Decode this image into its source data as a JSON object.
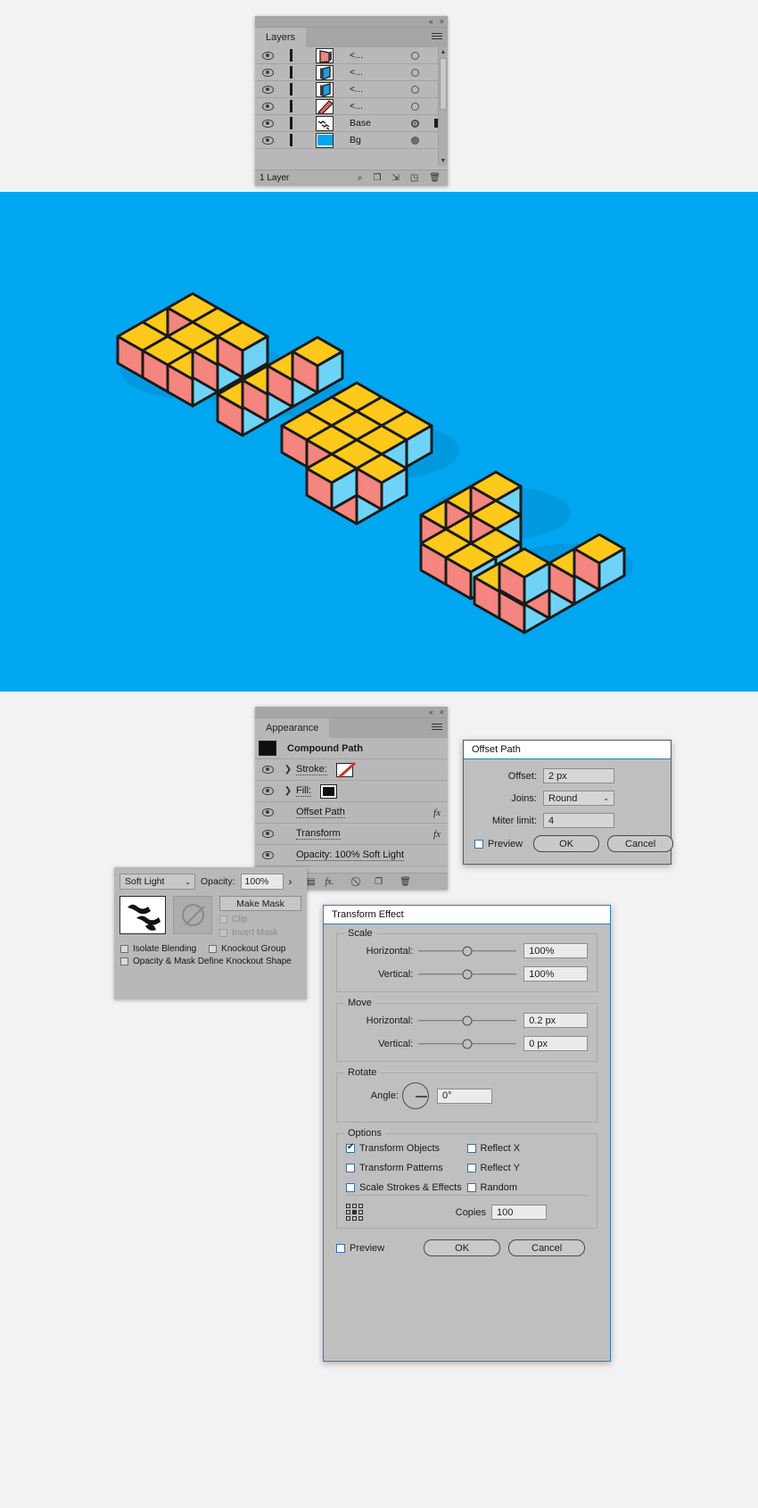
{
  "layers_panel": {
    "tab_label": "Layers",
    "rows": [
      {
        "name": "<...",
        "thumb": "isometric-red-face",
        "selected": false
      },
      {
        "name": "<...",
        "thumb": "isometric-blue-face",
        "selected": false
      },
      {
        "name": "<...",
        "thumb": "isometric-blue-face",
        "selected": false
      },
      {
        "name": "<...",
        "thumb": "diagonal-red-stripe",
        "selected": false
      },
      {
        "name": "Base",
        "thumb": "scribble-paths",
        "selected": true
      },
      {
        "name": "Bg",
        "thumb": "solid-blue-fill",
        "selected": false
      }
    ],
    "footer_text": "1 Layer",
    "footer_icons": [
      "locate-object-icon",
      "make-clipping-mask-icon",
      "create-sublayer-icon",
      "create-new-layer-icon",
      "delete-selection-icon"
    ],
    "collapse_icon": "«",
    "close_icon": "×",
    "menu_icon": "panel-menu-icon"
  },
  "artwork": {
    "background_color": "#00a6f0",
    "top_face_color": "#ffc91b",
    "left_face_color": "#f4857f",
    "right_face_color": "#6fd3f7",
    "stroke_color": "#1a1a1a",
    "shadow_color": "#0090d4",
    "description": "isometric-3d-pixel-letters"
  },
  "appearance_panel": {
    "tab_label": "Appearance",
    "title_row": {
      "label": "Compound Path",
      "swatch": "black-fill"
    },
    "rows": [
      {
        "label": "Stroke:",
        "swatch": "red-diagonal-stroke",
        "has_arrow": true,
        "fx": false
      },
      {
        "label": "Fill:",
        "swatch": "black-fill",
        "has_arrow": true,
        "fx": false
      },
      {
        "label": "Offset Path",
        "has_arrow": false,
        "fx": true
      },
      {
        "label": "Transform",
        "has_arrow": false,
        "fx": true
      },
      {
        "label": "Opacity:  100% Soft Light",
        "has_arrow": false,
        "fx": false
      }
    ],
    "footer_icons": [
      "add-new-stroke-icon",
      "add-new-fill-icon",
      "add-new-effect-icon",
      "clear-appearance-icon",
      "duplicate-item-icon",
      "delete-item-icon"
    ],
    "collapse_icon": "«",
    "close_icon": "×"
  },
  "transparency_panel": {
    "blend_mode": "Soft Light",
    "opacity_label": "Opacity:",
    "opacity_value": "100%",
    "stepper_icon": "›",
    "make_mask_button": "Make Mask",
    "clip_label": "Clip",
    "invert_mask_label": "Invert Mask",
    "isolate_blending_label": "Isolate Blending",
    "knockout_group_label": "Knockout Group",
    "opacity_knockout_label": "Opacity & Mask Define Knockout Shape",
    "checks": {
      "clip": false,
      "invert_mask": false,
      "isolate_blending": false,
      "knockout_group": false,
      "opacity_knockout": false
    }
  },
  "offset_path_dialog": {
    "title": "Offset Path",
    "fields": [
      {
        "label": "Offset:",
        "value": "2 px",
        "type": "input"
      },
      {
        "label": "Joins:",
        "value": "Round",
        "type": "select"
      },
      {
        "label": "Miter limit:",
        "value": "4",
        "type": "input"
      }
    ],
    "preview_label": "Preview",
    "preview_checked": false,
    "ok_label": "OK",
    "cancel_label": "Cancel"
  },
  "transform_dialog": {
    "title": "Transform Effect",
    "scale": {
      "group_title": "Scale",
      "horizontal_label": "Horizontal:",
      "horizontal_value": "100%",
      "vertical_label": "Vertical:",
      "vertical_value": "100%"
    },
    "move": {
      "group_title": "Move",
      "horizontal_label": "Horizontal:",
      "horizontal_value": "0.2 px",
      "vertical_label": "Vertical:",
      "vertical_value": "0 px"
    },
    "rotate": {
      "group_title": "Rotate",
      "angle_label": "Angle:",
      "angle_value": "0°"
    },
    "options": {
      "group_title": "Options",
      "items": [
        {
          "label": "Transform Objects",
          "checked": true
        },
        {
          "label": "Reflect X",
          "checked": false
        },
        {
          "label": "Transform Patterns",
          "checked": false
        },
        {
          "label": "Reflect Y",
          "checked": false
        },
        {
          "label": "Scale Strokes & Effects",
          "checked": false
        },
        {
          "label": "Random",
          "checked": false
        }
      ]
    },
    "copies_label": "Copies",
    "copies_value": "100",
    "preview_label": "Preview",
    "preview_checked": false,
    "ok_label": "OK",
    "cancel_label": "Cancel"
  }
}
